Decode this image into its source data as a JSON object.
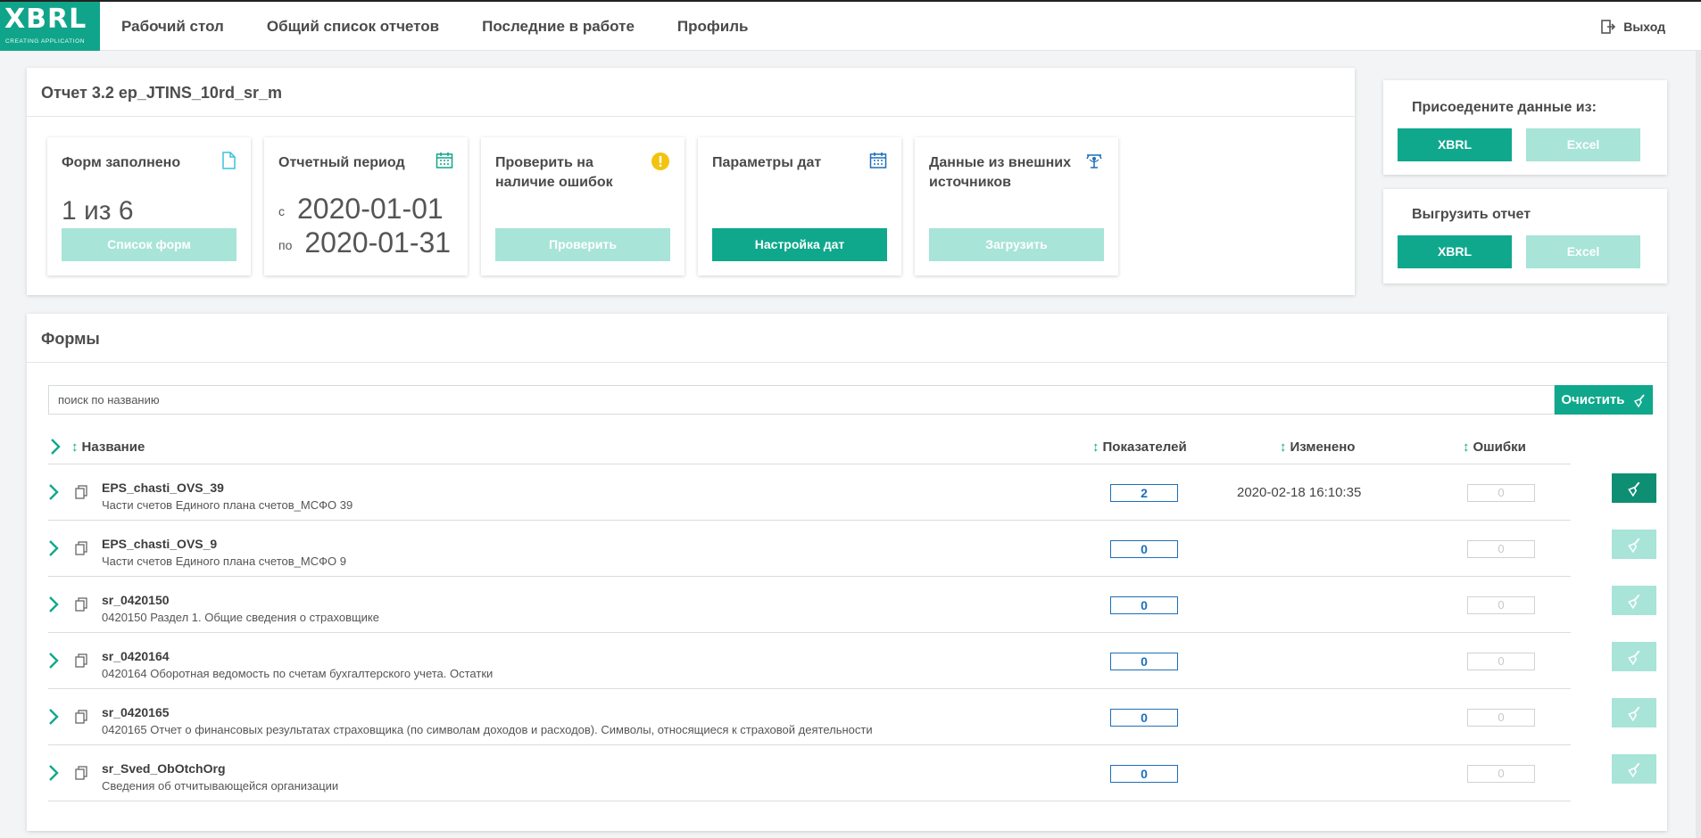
{
  "brand": {
    "logo_main": "XBRL",
    "logo_sub": "CREATING APPLICATION",
    "accent": "#0fa88c",
    "accent_disabled": "#a8e4d8"
  },
  "nav": {
    "items": [
      {
        "label": "Рабочий стол"
      },
      {
        "label": "Общий список отчетов"
      },
      {
        "label": "Последние в работе"
      },
      {
        "label": "Профиль"
      }
    ],
    "logout_label": "Выход"
  },
  "report": {
    "title": "Отчет 3.2 ep_JTINS_10rd_sr_m",
    "tiles": {
      "forms": {
        "title": "Форм заполнено",
        "value": "1 из 6",
        "button": "Список форм",
        "icon": "document-icon"
      },
      "period": {
        "title": "Отчетный период",
        "from_prefix": "с",
        "from": "2020-01-01",
        "to_prefix": "по",
        "to": "2020-01-31",
        "icon": "calendar-icon"
      },
      "check": {
        "title": "Проверить на наличие ошибок",
        "button": "Проверить",
        "icon": "warning-icon"
      },
      "dates": {
        "title": "Параметры дат",
        "button": "Настройка дат",
        "icon": "calendar-icon"
      },
      "external": {
        "title": "Данные из внешних источников",
        "button": "Загрузить",
        "icon": "satellite-icon"
      }
    }
  },
  "attach": {
    "title": "Присоедените данные из:",
    "xbrl": "XBRL",
    "excel": "Excel"
  },
  "export": {
    "title": "Выгрузить отчет",
    "xbrl": "XBRL",
    "excel": "Excel"
  },
  "forms": {
    "title": "Формы",
    "search_placeholder": "поиск по названию",
    "clear_label": "Очистить",
    "columns": {
      "name": "Название",
      "indicators": "Показателей",
      "changed": "Изменено",
      "errors": "Ошибки"
    },
    "rows": [
      {
        "code": "EPS_chasti_OVS_39",
        "desc": "Части счетов Единого плана счетов_МСФО 39",
        "indicators": "2",
        "changed": "2020-02-18 16:10:35",
        "errors": "0",
        "active": true
      },
      {
        "code": "EPS_chasti_OVS_9",
        "desc": "Части счетов Единого плана счетов_МСФО 9",
        "indicators": "0",
        "changed": "",
        "errors": "0",
        "active": false
      },
      {
        "code": "sr_0420150",
        "desc": "0420150 Раздел 1. Общие сведения о страховщике",
        "indicators": "0",
        "changed": "",
        "errors": "0",
        "active": false
      },
      {
        "code": "sr_0420164",
        "desc": "0420164 Оборотная ведомость по счетам бухгалтерского учета. Остатки",
        "indicators": "0",
        "changed": "",
        "errors": "0",
        "active": false
      },
      {
        "code": "sr_0420165",
        "desc": "0420165 Отчет о финансовых результатах страховщика (по символам доходов и расходов). Символы, относящиеся к страховой деятельности",
        "indicators": "0",
        "changed": "",
        "errors": "0",
        "active": false
      },
      {
        "code": "sr_Sved_ObOtchOrg",
        "desc": "Сведения об отчитывающейся организации",
        "indicators": "0",
        "changed": "",
        "errors": "0",
        "active": false
      }
    ]
  }
}
